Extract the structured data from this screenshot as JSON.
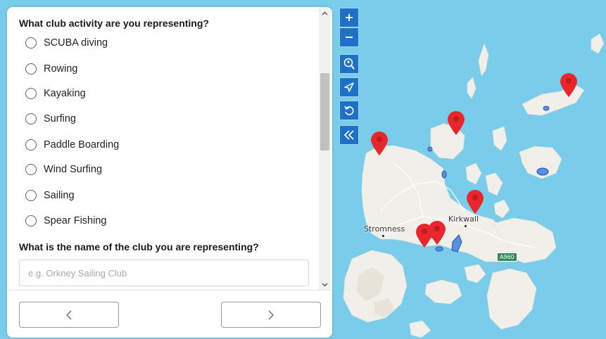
{
  "form": {
    "question_activity": "What club activity are you representing?",
    "activities": [
      {
        "label": "SCUBA diving",
        "selected": false
      },
      {
        "label": "Rowing",
        "selected": false
      },
      {
        "label": "Kayaking",
        "selected": false
      },
      {
        "label": "Surfing",
        "selected": false
      },
      {
        "label": "Paddle Boarding",
        "selected": false
      },
      {
        "label": "Wind Surfing",
        "selected": false
      },
      {
        "label": "Sailing",
        "selected": false
      },
      {
        "label": "Spear Fishing",
        "selected": false
      }
    ],
    "question_club_name": "What is the name of the club you are representing?",
    "club_name_value": "",
    "club_name_placeholder": "e.g. Orkney Sailing Club",
    "back_button": {
      "icon": "chevron-left-icon"
    },
    "next_button": {
      "icon": "chevron-right-icon"
    }
  },
  "map": {
    "labels": {
      "kirkwall": "Kirkwall",
      "stromness": "Stromness",
      "road": "A960"
    },
    "controls": [
      {
        "name": "zoom-in",
        "icon": "plus-icon"
      },
      {
        "name": "zoom-out",
        "icon": "minus-icon"
      },
      {
        "name": "search-location",
        "icon": "search-location-icon"
      },
      {
        "name": "locate",
        "icon": "navigation-arrow-icon"
      },
      {
        "name": "reset",
        "icon": "undo-icon"
      },
      {
        "name": "collapse-panel",
        "icon": "double-chevron-left-icon"
      }
    ],
    "marker_count": 6,
    "colors": {
      "sea": "#79cdea",
      "land": "#f1efe9",
      "control": "#1d72c8",
      "marker": "#e8262b",
      "road_shield": "#2e8b57"
    }
  }
}
